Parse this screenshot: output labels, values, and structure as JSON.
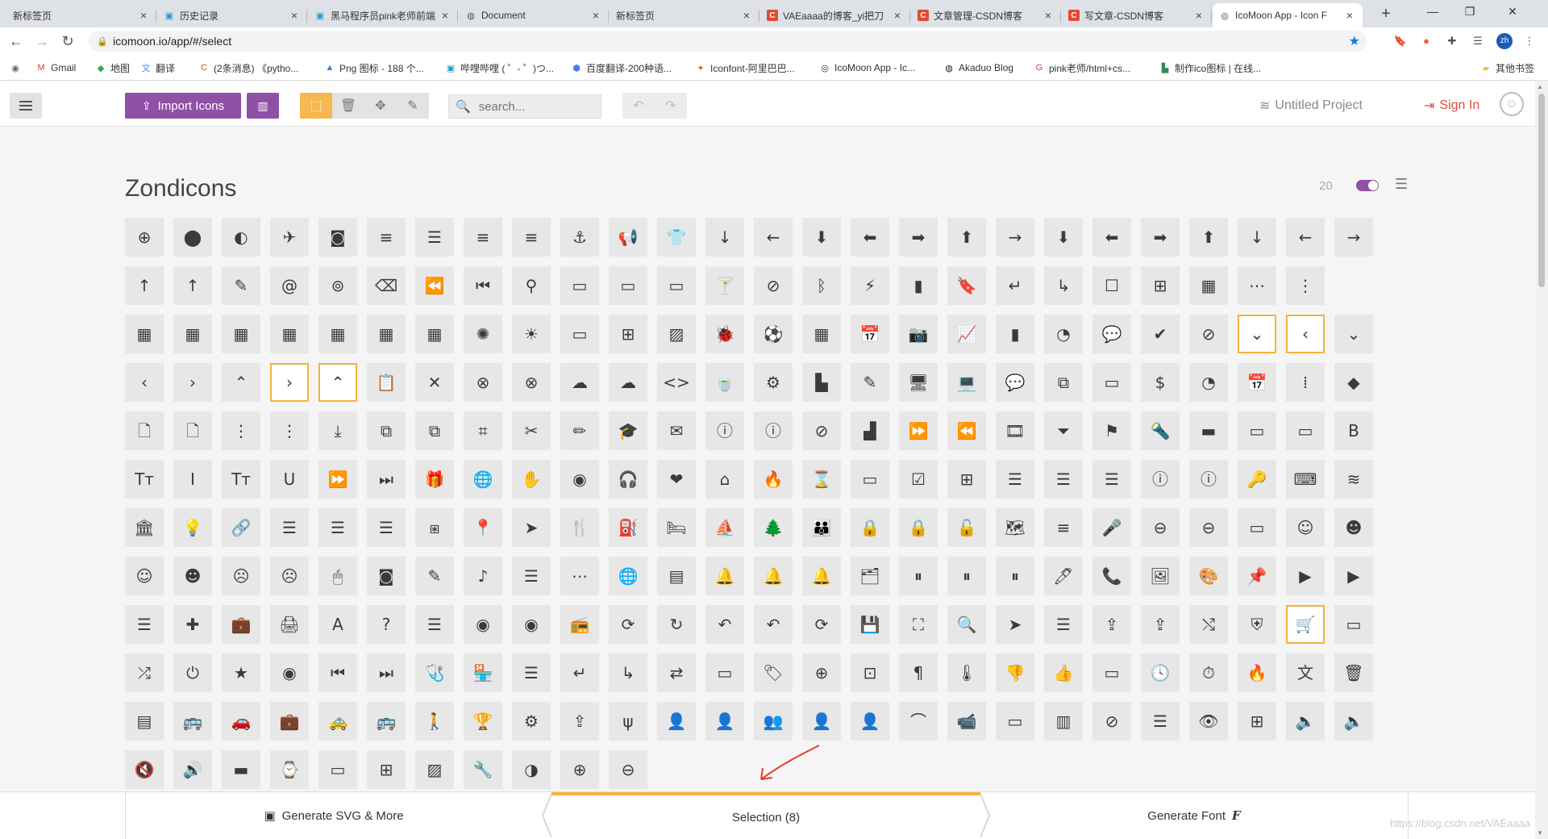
{
  "browser": {
    "tabs": [
      {
        "title": "新标签页",
        "icon": "none-icon"
      },
      {
        "title": "历史记录",
        "icon": "bilibili-icon"
      },
      {
        "title": "黑马程序员pink老师前端",
        "icon": "bilibili-icon"
      },
      {
        "title": "Document",
        "icon": "globe-icon"
      },
      {
        "title": "新标签页",
        "icon": "none-icon"
      },
      {
        "title": "VAEaaaa的博客_yi把刀",
        "icon": "csdn-icon"
      },
      {
        "title": "文章管理-CSDN博客",
        "icon": "csdn-icon"
      },
      {
        "title": "写文章-CSDN博客",
        "icon": "csdn-icon"
      },
      {
        "title": "IcoMoon App - Icon F",
        "icon": "icomoon-icon",
        "active": true
      }
    ],
    "url": "icomoon.io/app/#/select",
    "bookmarks": [
      {
        "label": "Gmail"
      },
      {
        "label": "地图"
      },
      {
        "label": "翻译"
      },
      {
        "label": "(2条消息) 《pytho..."
      },
      {
        "label": "Png 图标 - 188 个..."
      },
      {
        "label": "哔哩哔哩 ( ゜- ゜)つ..."
      },
      {
        "label": "百度翻译-200种语..."
      },
      {
        "label": "Iconfont-阿里巴巴..."
      },
      {
        "label": "IcoMoon App - Ic..."
      },
      {
        "label": "Akaduo Blog"
      },
      {
        "label": "pink老师/html+cs..."
      },
      {
        "label": "制作ico图标 | 在线..."
      },
      {
        "label": "其他书签"
      }
    ],
    "profile_initials": "zh"
  },
  "header": {
    "import_label": "Import Icons",
    "search_placeholder": "search...",
    "project_label": "Untitled Project",
    "signin_label": "Sign In"
  },
  "iconset": {
    "title": "Zondicons",
    "count": "20",
    "rows": [
      [
        "⊕",
        "⬤",
        "◐",
        "✈",
        "◙",
        "≡",
        "☰",
        "≡",
        "≡",
        "⚓",
        "📢",
        "👕",
        "↓",
        "←",
        "⬇",
        "⬅",
        "➡",
        "⬆",
        "→",
        "⬇",
        "⬅",
        "➡",
        "⬆",
        "↓",
        "←",
        "→"
      ],
      [
        "↑",
        "↑",
        "✎",
        "@",
        "⊚",
        "⌫",
        "⏪",
        "⏮",
        "⚲",
        "▭",
        "▭",
        "▭",
        "🍸",
        "⊘",
        "ᛒ",
        "⚡",
        "▮",
        "🔖",
        "↵",
        "↳",
        "☐",
        "⊞",
        "▦",
        "⋯",
        "⋮"
      ],
      [
        "▦",
        "▦",
        "▦",
        "▦",
        "▦",
        "▦",
        "▦",
        "✺",
        "☀",
        "▭",
        "⊞",
        "▨",
        "🐞",
        "⚽",
        "▦",
        "📅",
        "📷",
        "📈",
        "▮",
        "◔",
        "💬",
        "✔",
        "⊘",
        "⌄",
        "‹",
        "⌄"
      ],
      [
        "‹",
        "›",
        "⌃",
        "›",
        "⌃",
        "📋",
        "✕",
        "⊗",
        "⊗",
        "☁",
        "☁",
        "<>",
        "🍵",
        "⚙",
        "▙",
        "✎",
        "🖥",
        "💻",
        "💬",
        "⧉",
        "▭",
        "$",
        "◔",
        "📅",
        "⁞",
        "◆"
      ],
      [
        "🗋",
        "🗋",
        "⋮",
        "⋮",
        "⤓",
        "⧉",
        "⧉",
        "⌗",
        "✂",
        "✏",
        "🎓",
        "✉",
        "ⓘ",
        "ⓘ",
        "⊘",
        "▟",
        "⏩",
        "⏪",
        "🎞",
        "⏷",
        "⚑",
        "🔦",
        "▬",
        "▭",
        "▭",
        "B"
      ],
      [
        "Tт",
        "I",
        "Tт",
        "U",
        "⏩",
        "⏭",
        "🎁",
        "🌐",
        "✋",
        "◉",
        "🎧",
        "❤",
        "⌂",
        "🔥",
        "⌛",
        "▭",
        "☑",
        "⊞",
        "☰",
        "☰",
        "☰",
        "ⓘ",
        "ⓘ",
        "🔑",
        "⌨",
        "≋"
      ],
      [
        "🏛",
        "💡",
        "🔗",
        "☰",
        "☰",
        "☰",
        "⧆",
        "📍",
        "➤",
        "🍴",
        "⛽",
        "🛏",
        "⛵",
        "🌲",
        "👪",
        "🔒",
        "🔒",
        "🔓",
        "🗺",
        "≡",
        "🎤",
        "⊖",
        "⊖",
        "▭",
        "☺",
        "☻"
      ],
      [
        "☺",
        "☻",
        "☹",
        "☹",
        "🖱",
        "◙",
        "✎",
        "♪",
        "☰",
        "⋯",
        "🌐",
        "▤",
        "🔔",
        "🔔",
        "🔔",
        "🗂",
        "⏸",
        "⏸",
        "⏸",
        "🖊",
        "📞",
        "🖼",
        "🎨",
        "📌",
        "▶",
        "▶"
      ],
      [
        "☰",
        "✚",
        "💼",
        "🖨",
        "A",
        "?",
        "☰",
        "◉",
        "◉",
        "📻",
        "⟳",
        "↻",
        "↶",
        "↶",
        "⟳",
        "💾",
        "⛶",
        "🔍",
        "➤",
        "☰",
        "⇪",
        "⇪",
        "⤭",
        "⛨",
        "🛒",
        "▭"
      ],
      [
        "⤮",
        "⏻",
        "★",
        "◉",
        "⏮",
        "⏭",
        "🩺",
        "🏪",
        "☰",
        "↵",
        "↳",
        "⇄",
        "▭",
        "🏷",
        "⊕",
        "⊡",
        "¶",
        "🌡",
        "👎",
        "👍",
        "▭",
        "🕓",
        "⏱",
        "🔥",
        "文",
        "🗑"
      ],
      [
        "▤",
        "🚌",
        "🚗",
        "💼",
        "🚕",
        "🚌",
        "🚶",
        "🏆",
        "⚙",
        "⇪",
        "ψ",
        "👤",
        "👤",
        "👥",
        "👤",
        "👤",
        "⌒",
        "📹",
        "▭",
        "▥",
        "⊘",
        "☰",
        "👁",
        "⊞",
        "🔈",
        "🔈"
      ],
      [
        "🔇",
        "🔊",
        "▬",
        "⌚",
        "▭",
        "⊞",
        "▨",
        "🔧",
        "◑",
        "⊕",
        "⊖"
      ]
    ],
    "selected": [
      [
        2,
        23
      ],
      [
        2,
        24
      ],
      [
        3,
        3
      ],
      [
        3,
        4
      ],
      [
        8,
        24
      ]
    ]
  },
  "footer": {
    "generate_svg_label": "Generate SVG & More",
    "selection_label": "Selection (8)",
    "generate_font_label": "Generate Font",
    "watermark": "https://blog.csdn.net/VAEaaaa"
  },
  "colors": {
    "accent_purple": "#8e51a5",
    "selection_orange": "#f4b33d",
    "signin_red": "#e14b3b"
  }
}
